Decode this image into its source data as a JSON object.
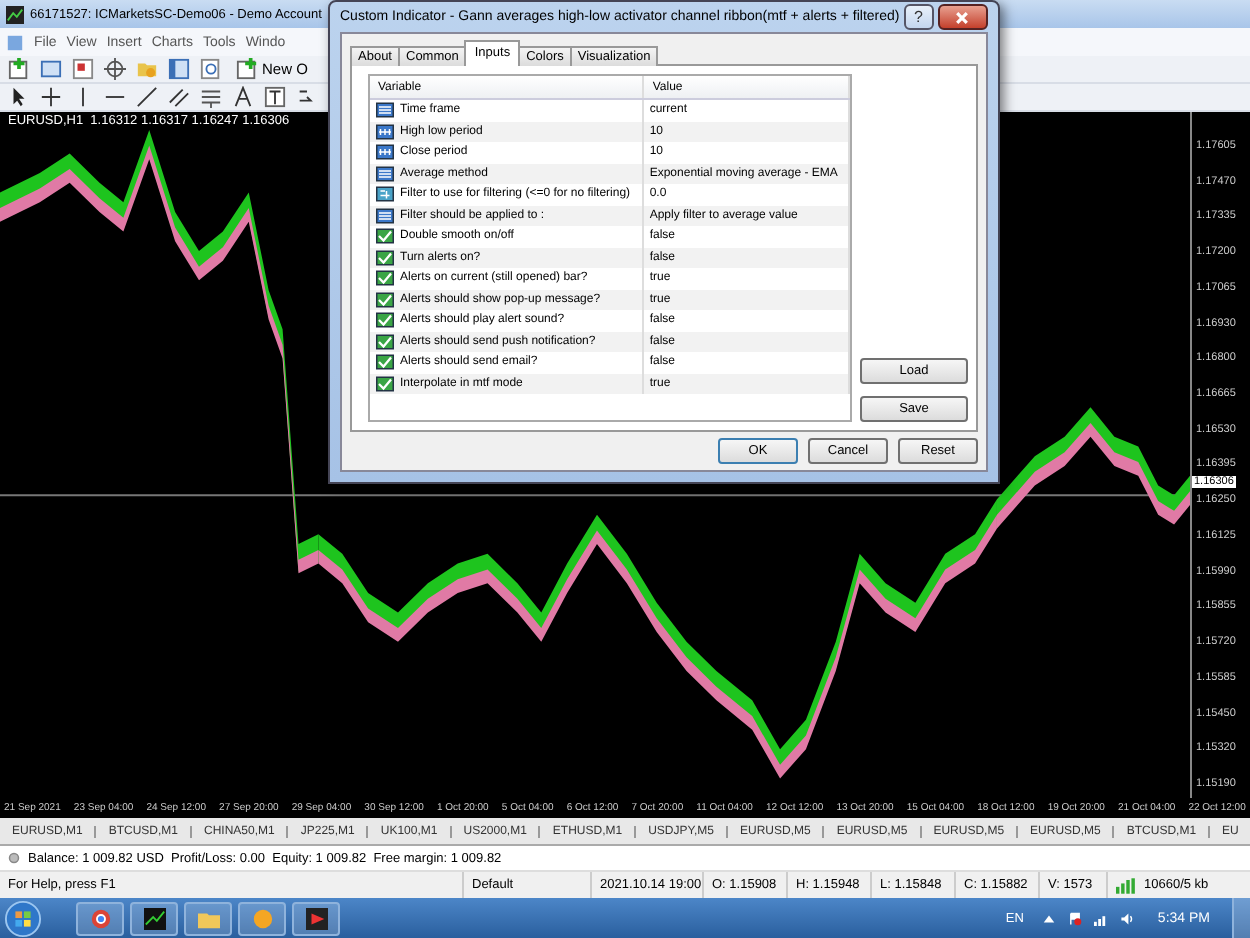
{
  "main_window": {
    "title": "66171527: ICMarketsSC-Demo06 - Demo Account"
  },
  "menu": [
    "File",
    "View",
    "Insert",
    "Charts",
    "Tools",
    "Windo"
  ],
  "toolbar": {
    "new_order": "New O"
  },
  "chart": {
    "header": "EURUSD,H1  1.16312 1.16317 1.16247 1.16306",
    "price_labels": [
      "1.17605",
      "1.17470",
      "1.17335",
      "1.17200",
      "1.17065",
      "1.16930",
      "1.16800",
      "1.16665",
      "1.16530",
      "1.16395",
      "1.16250",
      "1.16125",
      "1.15990",
      "1.15855",
      "1.15720",
      "1.15585",
      "1.15450",
      "1.15320",
      "1.15190"
    ],
    "current_price": "1.16306",
    "time_labels": [
      "21 Sep 2021",
      "23 Sep 04:00",
      "24 Sep 12:00",
      "27 Sep 20:00",
      "29 Sep 04:00",
      "30 Sep 12:00",
      "1 Oct 20:00",
      "5 Oct 04:00",
      "6 Oct 12:00",
      "7 Oct 20:00",
      "11 Oct 04:00",
      "12 Oct 12:00",
      "13 Oct 20:00",
      "15 Oct 04:00",
      "18 Oct 12:00",
      "19 Oct 20:00",
      "21 Oct 04:00",
      "22 Oct 12:00"
    ]
  },
  "symbol_tabs": [
    {
      "label": "EURUSD,M1",
      "selected": false
    },
    {
      "label": "BTCUSD,M1",
      "selected": false
    },
    {
      "label": "CHINA50,M1",
      "selected": false
    },
    {
      "label": "JP225,M1",
      "selected": false
    },
    {
      "label": "UK100,M1",
      "selected": false
    },
    {
      "label": "US2000,M1",
      "selected": false
    },
    {
      "label": "ETHUSD,M1",
      "selected": false
    },
    {
      "label": "USDJPY,M5",
      "selected": false
    },
    {
      "label": "EURUSD,M5",
      "selected": false
    },
    {
      "label": "EURUSD,M5",
      "selected": false
    },
    {
      "label": "EURUSD,M5",
      "selected": false
    },
    {
      "label": "EURUSD,M5",
      "selected": false
    },
    {
      "label": "BTCUSD,M1",
      "selected": false
    },
    {
      "label": "EU",
      "selected": false
    }
  ],
  "account_bar": "Balance: 1 009.82 USD  Profit/Loss: 0.00  Equity: 1 009.82  Free margin: 1 009.82",
  "status_bar": {
    "help": "For Help, press F1",
    "profile": "Default",
    "time": "2021.10.14 19:00",
    "open": "O: 1.15908",
    "high": "H: 1.15948",
    "low": "L: 1.15848",
    "close": "C: 1.15882",
    "volume": "V: 1573",
    "traffic": "10660/5 kb"
  },
  "taskbar": {
    "language": "EN",
    "clock": "5:34 PM"
  },
  "dialog": {
    "title": "Custom Indicator - Gann averages high-low activator channel ribbon(mtf + alerts + filtered)",
    "help": "?",
    "tabs": [
      {
        "label": "About",
        "selected": false
      },
      {
        "label": "Common",
        "selected": false
      },
      {
        "label": "Inputs",
        "selected": true
      },
      {
        "label": "Colors",
        "selected": false
      },
      {
        "label": "Visualization",
        "selected": false
      }
    ],
    "columns": [
      "Variable",
      "Value"
    ],
    "inputs": [
      {
        "kind": "enum",
        "name": "Time frame",
        "value": "current"
      },
      {
        "kind": "int",
        "name": "High low period",
        "value": "10"
      },
      {
        "kind": "int",
        "name": "Close period",
        "value": "10"
      },
      {
        "kind": "enum",
        "name": "Average method",
        "value": "Exponential moving average - EMA"
      },
      {
        "kind": "double",
        "name": "Filter to use for filtering (<=0 for no filtering)",
        "value": "0.0"
      },
      {
        "kind": "enum",
        "name": "Filter should be applied to :",
        "value": "Apply filter to average value"
      },
      {
        "kind": "bool",
        "name": "Double smooth on/off",
        "value": "false"
      },
      {
        "kind": "bool",
        "name": "Turn alerts on?",
        "value": "false"
      },
      {
        "kind": "bool",
        "name": "Alerts on current (still opened) bar?",
        "value": "true"
      },
      {
        "kind": "bool",
        "name": "Alerts should show pop-up message?",
        "value": "true"
      },
      {
        "kind": "bool",
        "name": "Alerts should play alert sound?",
        "value": "false"
      },
      {
        "kind": "bool",
        "name": "Alerts should send push notification?",
        "value": "false"
      },
      {
        "kind": "bool",
        "name": "Alerts should send email?",
        "value": "false"
      },
      {
        "kind": "bool",
        "name": "Interpolate in mtf mode",
        "value": "true"
      }
    ],
    "side_buttons": [
      "Load",
      "Save"
    ],
    "buttons": [
      "OK",
      "Cancel",
      "Reset"
    ]
  }
}
